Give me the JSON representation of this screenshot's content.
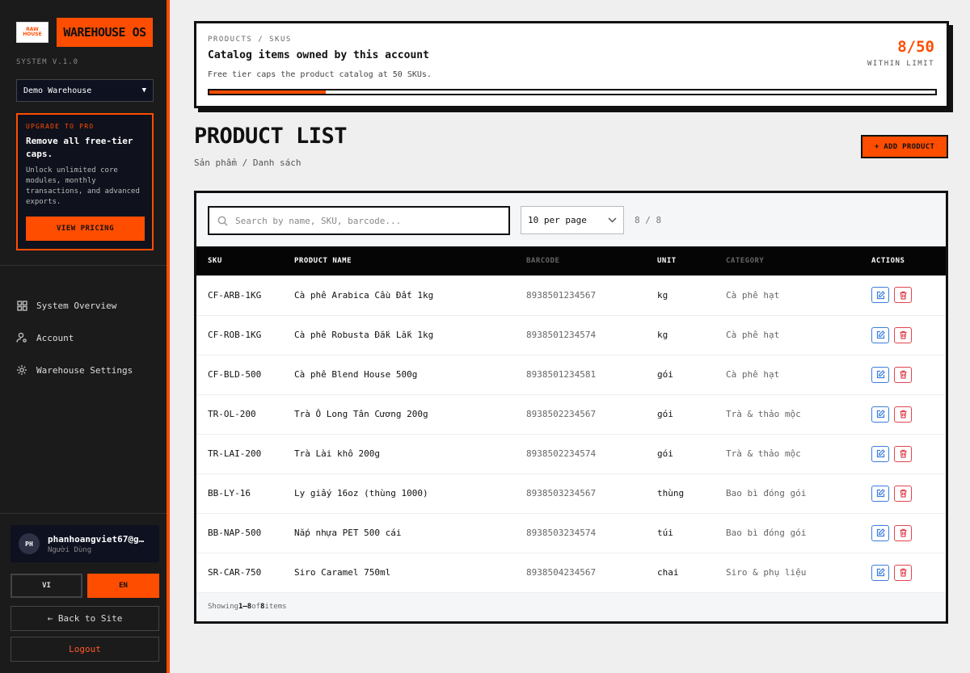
{
  "sidebar": {
    "logo_text": "RAW HOUSE",
    "brand": "WAREHOUSE OS",
    "version": "SYSTEM V.1.0",
    "warehouse_select": "Demo Warehouse",
    "upgrade": {
      "kicker": "UPGRADE TO PRO",
      "title": "Remove all free-tier caps.",
      "desc": "Unlock unlimited core modules, monthly transactions, and advanced exports.",
      "button": "VIEW PRICING"
    },
    "nav": [
      {
        "label": "System Overview",
        "icon": "grid-icon"
      },
      {
        "label": "Account",
        "icon": "user-settings-icon"
      },
      {
        "label": "Warehouse Settings",
        "icon": "gear-icon"
      }
    ],
    "user": {
      "initials": "PH",
      "email": "phanhoangviet67@g…",
      "role": "Người Dùng"
    },
    "lang": {
      "vi": "VI",
      "en": "EN",
      "active": "EN"
    },
    "back": "← Back to Site",
    "logout": "Logout"
  },
  "quota": {
    "crumb": "PRODUCTS / SKUS",
    "heading": "Catalog items owned by this account",
    "sub": "Free tier caps the product catalog at 50 SKUs.",
    "count": "8/50",
    "status": "WITHIN LIMIT",
    "used": 8,
    "limit": 50
  },
  "page": {
    "title": "PRODUCT LIST",
    "crumb": "Sản phẩm / Danh sách",
    "add_button": "+ ADD PRODUCT"
  },
  "toolbar": {
    "search_placeholder": "Search by name, SKU, barcode...",
    "per_page": "10 per page",
    "count": "8 / 8"
  },
  "table": {
    "columns": [
      "SKU",
      "PRODUCT NAME",
      "BARCODE",
      "UNIT",
      "CATEGORY",
      "ACTIONS"
    ],
    "rows": [
      {
        "sku": "CF-ARB-1KG",
        "name": "Cà phê Arabica Cầu Đất 1kg",
        "barcode": "8938501234567",
        "unit": "kg",
        "category": "Cà phê hạt"
      },
      {
        "sku": "CF-ROB-1KG",
        "name": "Cà phê Robusta Đắk Lắk 1kg",
        "barcode": "8938501234574",
        "unit": "kg",
        "category": "Cà phê hạt"
      },
      {
        "sku": "CF-BLD-500",
        "name": "Cà phê Blend House 500g",
        "barcode": "8938501234581",
        "unit": "gói",
        "category": "Cà phê hạt"
      },
      {
        "sku": "TR-OL-200",
        "name": "Trà Ô Long Tân Cương 200g",
        "barcode": "8938502234567",
        "unit": "gói",
        "category": "Trà & thảo mộc"
      },
      {
        "sku": "TR-LAI-200",
        "name": "Trà Lài khô 200g",
        "barcode": "8938502234574",
        "unit": "gói",
        "category": "Trà & thảo mộc"
      },
      {
        "sku": "BB-LY-16",
        "name": "Ly giấy 16oz (thùng 1000)",
        "barcode": "8938503234567",
        "unit": "thùng",
        "category": "Bao bì đóng gói"
      },
      {
        "sku": "BB-NAP-500",
        "name": "Nắp nhựa PET 500 cái",
        "barcode": "8938503234574",
        "unit": "túi",
        "category": "Bao bì đóng gói"
      },
      {
        "sku": "SR-CAR-750",
        "name": "Siro Caramel 750ml",
        "barcode": "8938504234567",
        "unit": "chai",
        "category": "Siro & phụ liệu"
      }
    ],
    "footer": {
      "prefix": "Showing ",
      "range": "1–8",
      "mid": " of ",
      "total": "8",
      "suffix": " items"
    }
  },
  "colors": {
    "accent": "#ff4d00",
    "sidebar_bg": "#1b1b1b",
    "edit": "#3b7ddd",
    "delete": "#e0454f"
  }
}
